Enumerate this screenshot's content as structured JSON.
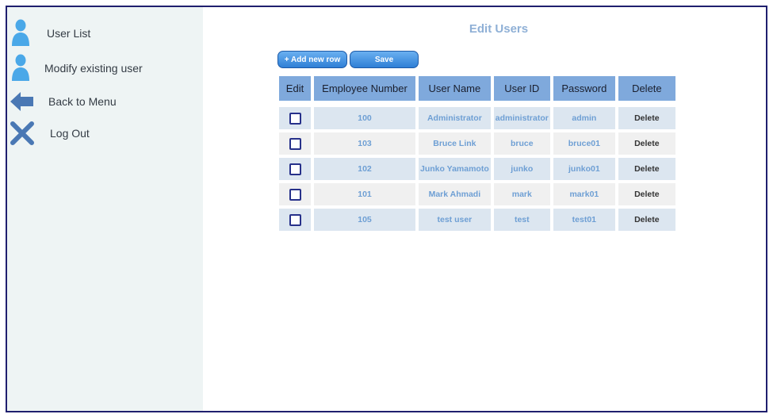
{
  "sidebar": {
    "items": [
      {
        "label": "User List",
        "icon": "user-icon"
      },
      {
        "label": "Modify existing user",
        "icon": "user-icon"
      },
      {
        "label": "Back to Menu",
        "icon": "arrow-left-icon"
      },
      {
        "label": "Log Out",
        "icon": "close-icon"
      }
    ]
  },
  "main": {
    "title": "Edit Users",
    "add_row_label": "+ Add new row",
    "save_label": "Save"
  },
  "table": {
    "headers": [
      "Edit",
      "Employee Number",
      "User Name",
      "User ID",
      "Password",
      "Delete"
    ],
    "rows": [
      {
        "employee_number": "100",
        "user_name": "Administrator",
        "user_id": "administrator",
        "password": "admin",
        "delete": "Delete"
      },
      {
        "employee_number": "103",
        "user_name": "Bruce Link",
        "user_id": "bruce",
        "password": "bruce01",
        "delete": "Delete"
      },
      {
        "employee_number": "102",
        "user_name": "Junko Yamamoto",
        "user_id": "junko",
        "password": "junko01",
        "delete": "Delete"
      },
      {
        "employee_number": "101",
        "user_name": "Mark Ahmadi",
        "user_id": "mark",
        "password": "mark01",
        "delete": "Delete"
      },
      {
        "employee_number": "105",
        "user_name": "test user",
        "user_id": "test",
        "password": "test01",
        "delete": "Delete"
      }
    ]
  },
  "colors": {
    "frame_border": "#1f1f6e",
    "sidebar_bg": "#eef4f4",
    "header_bg": "#7fa9dc",
    "row_odd": "#dce6f0",
    "row_even": "#f0f0f0",
    "accent_text": "#6e9fd4",
    "button": "#2e7fd6"
  }
}
